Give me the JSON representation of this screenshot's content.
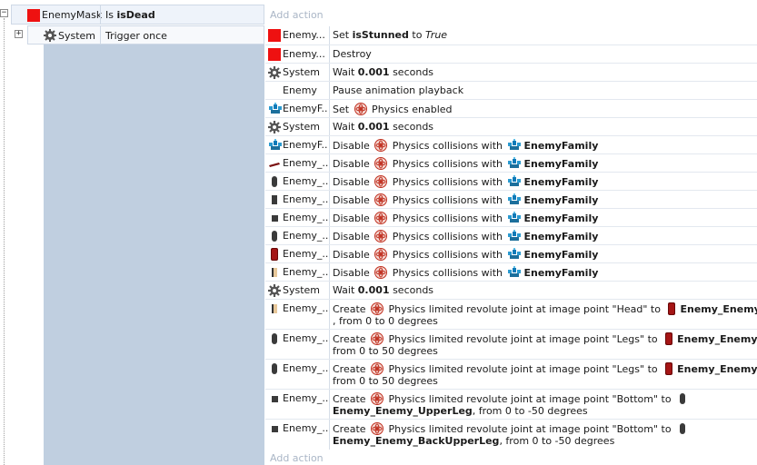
{
  "condition": {
    "object": "EnemyMask",
    "text_prefix": "Is",
    "text_bold": "isDead",
    "add_action": "Add action"
  },
  "subevent": {
    "object": "System",
    "text": "Trigger once"
  },
  "actions": [
    {
      "object": "Enemy...",
      "icon": "red-square",
      "parts": [
        {
          "t": "Set "
        },
        {
          "b": "isStunned"
        },
        {
          "t": " to "
        },
        {
          "i": "True"
        }
      ]
    },
    {
      "object": "Enemy...",
      "icon": "red-square",
      "parts": [
        {
          "t": "Destroy"
        }
      ]
    },
    {
      "object": "System",
      "icon": "gear",
      "parts": [
        {
          "t": "Wait "
        },
        {
          "b": "0.001"
        },
        {
          "t": " seconds"
        }
      ]
    },
    {
      "object": "Enemy",
      "icon": "none",
      "parts": [
        {
          "t": "Pause animation playback"
        }
      ]
    },
    {
      "object": "EnemyF...",
      "icon": "family",
      "parts": [
        {
          "t": "Set "
        },
        {
          "beh": "physics"
        },
        {
          "t": " Physics enabled"
        }
      ]
    },
    {
      "object": "System",
      "icon": "gear",
      "parts": [
        {
          "t": "Wait "
        },
        {
          "b": "0.001"
        },
        {
          "t": " seconds"
        }
      ]
    },
    {
      "object": "EnemyF...",
      "icon": "family",
      "parts": [
        {
          "t": "Disable "
        },
        {
          "beh": "physics"
        },
        {
          "t": " Physics collisions with "
        },
        {
          "fam": "family"
        },
        {
          "b": "EnemyFamily"
        }
      ]
    },
    {
      "object": "Enemy_...",
      "icon": "sprite-flat",
      "parts": [
        {
          "t": "Disable "
        },
        {
          "beh": "physics"
        },
        {
          "t": " Physics collisions with "
        },
        {
          "fam": "family"
        },
        {
          "b": "EnemyFamily"
        }
      ]
    },
    {
      "object": "Enemy_...",
      "icon": "sprite-capsule",
      "parts": [
        {
          "t": "Disable "
        },
        {
          "beh": "physics"
        },
        {
          "t": " Physics collisions with "
        },
        {
          "fam": "family"
        },
        {
          "b": "EnemyFamily"
        }
      ]
    },
    {
      "object": "Enemy_...",
      "icon": "sprite-rect",
      "parts": [
        {
          "t": "Disable "
        },
        {
          "beh": "physics"
        },
        {
          "t": " Physics collisions with "
        },
        {
          "fam": "family"
        },
        {
          "b": "EnemyFamily"
        }
      ]
    },
    {
      "object": "Enemy_...",
      "icon": "sprite-square",
      "parts": [
        {
          "t": "Disable "
        },
        {
          "beh": "physics"
        },
        {
          "t": " Physics collisions with "
        },
        {
          "fam": "family"
        },
        {
          "b": "EnemyFamily"
        }
      ]
    },
    {
      "object": "Enemy_...",
      "icon": "sprite-capsule",
      "parts": [
        {
          "t": "Disable "
        },
        {
          "beh": "physics"
        },
        {
          "t": " Physics collisions with "
        },
        {
          "fam": "family"
        },
        {
          "b": "EnemyFamily"
        }
      ]
    },
    {
      "object": "Enemy_...",
      "icon": "sprite-body",
      "parts": [
        {
          "t": "Disable "
        },
        {
          "beh": "physics"
        },
        {
          "t": " Physics collisions with "
        },
        {
          "fam": "family"
        },
        {
          "b": "EnemyFamily"
        }
      ]
    },
    {
      "object": "Enemy_...",
      "icon": "sprite-head",
      "parts": [
        {
          "t": "Disable "
        },
        {
          "beh": "physics"
        },
        {
          "t": " Physics collisions with "
        },
        {
          "fam": "family"
        },
        {
          "b": "EnemyFamily"
        }
      ]
    },
    {
      "object": "System",
      "icon": "gear",
      "parts": [
        {
          "t": "Wait "
        },
        {
          "b": "0.001"
        },
        {
          "t": " seconds"
        }
      ]
    },
    {
      "object": "Enemy_...",
      "icon": "sprite-head",
      "line2": ", from 0 to 0 degrees",
      "parts": [
        {
          "t": "Create "
        },
        {
          "beh": "physics"
        },
        {
          "t": " Physics limited revolute joint at image point \"Head\" to "
        },
        {
          "spr": "sprite-body"
        },
        {
          "b": "Enemy_Enemy_Body"
        }
      ]
    },
    {
      "object": "Enemy_...",
      "icon": "sprite-capsule",
      "line2": "from 0 to 50 degrees",
      "parts": [
        {
          "t": "Create "
        },
        {
          "beh": "physics"
        },
        {
          "t": " Physics limited revolute joint at image point \"Legs\" to "
        },
        {
          "spr": "sprite-body"
        },
        {
          "b": "Enemy_Enemy_Body"
        },
        {
          "t": ","
        }
      ]
    },
    {
      "object": "Enemy_...",
      "icon": "sprite-capsule",
      "line2": "from 0 to 50 degrees",
      "parts": [
        {
          "t": "Create "
        },
        {
          "beh": "physics"
        },
        {
          "t": " Physics limited revolute joint at image point \"Legs\" to "
        },
        {
          "spr": "sprite-body"
        },
        {
          "b": "Enemy_Enemy_Body"
        },
        {
          "t": ","
        }
      ]
    },
    {
      "object": "Enemy_...",
      "icon": "sprite-square",
      "line2b": "Enemy_Enemy_UpperLeg",
      "line2": ", from 0 to -50 degrees",
      "parts": [
        {
          "t": "Create "
        },
        {
          "beh": "physics"
        },
        {
          "t": " Physics limited revolute joint at image point \"Bottom\" to "
        },
        {
          "spr": "sprite-capsule"
        }
      ]
    },
    {
      "object": "Enemy_...",
      "icon": "sprite-square",
      "line2b": "Enemy_Enemy_BackUpperLeg",
      "line2": ", from 0 to -50 degrees",
      "parts": [
        {
          "t": "Create "
        },
        {
          "beh": "physics"
        },
        {
          "t": " Physics limited revolute joint at image point \"Bottom\" to "
        },
        {
          "spr": "sprite-capsule"
        }
      ]
    }
  ],
  "add_action_bottom": "Add action",
  "colors": {
    "condition_bg": "#eef3fa",
    "left_panel": "#c0cfe0",
    "accent_red": "#ee1111"
  }
}
